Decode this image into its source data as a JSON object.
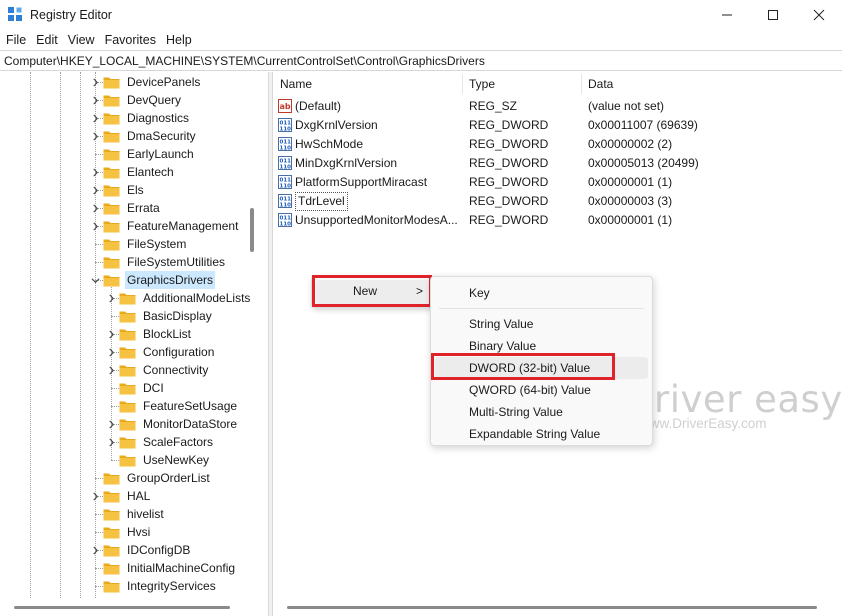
{
  "window": {
    "title": "Registry Editor"
  },
  "menu": [
    "File",
    "Edit",
    "View",
    "Favorites",
    "Help"
  ],
  "address": "Computer\\HKEY_LOCAL_MACHINE\\SYSTEM\\CurrentControlSet\\Control\\GraphicsDrivers",
  "tree": {
    "items": [
      {
        "label": "DevicePanels",
        "level": 0,
        "expander": "collapsed"
      },
      {
        "label": "DevQuery",
        "level": 0,
        "expander": "collapsed"
      },
      {
        "label": "Diagnostics",
        "level": 0,
        "expander": "collapsed"
      },
      {
        "label": "DmaSecurity",
        "level": 0,
        "expander": "collapsed"
      },
      {
        "label": "EarlyLaunch",
        "level": 0,
        "expander": "none"
      },
      {
        "label": "Elantech",
        "level": 0,
        "expander": "collapsed"
      },
      {
        "label": "Els",
        "level": 0,
        "expander": "collapsed"
      },
      {
        "label": "Errata",
        "level": 0,
        "expander": "collapsed"
      },
      {
        "label": "FeatureManagement",
        "level": 0,
        "expander": "collapsed"
      },
      {
        "label": "FileSystem",
        "level": 0,
        "expander": "none"
      },
      {
        "label": "FileSystemUtilities",
        "level": 0,
        "expander": "none"
      },
      {
        "label": "GraphicsDrivers",
        "level": 0,
        "expander": "expanded",
        "selected": true
      },
      {
        "label": "AdditionalModeLists",
        "level": 1,
        "expander": "collapsed"
      },
      {
        "label": "BasicDisplay",
        "level": 1,
        "expander": "none"
      },
      {
        "label": "BlockList",
        "level": 1,
        "expander": "collapsed"
      },
      {
        "label": "Configuration",
        "level": 1,
        "expander": "collapsed"
      },
      {
        "label": "Connectivity",
        "level": 1,
        "expander": "collapsed"
      },
      {
        "label": "DCI",
        "level": 1,
        "expander": "none"
      },
      {
        "label": "FeatureSetUsage",
        "level": 1,
        "expander": "none"
      },
      {
        "label": "MonitorDataStore",
        "level": 1,
        "expander": "collapsed"
      },
      {
        "label": "ScaleFactors",
        "level": 1,
        "expander": "collapsed"
      },
      {
        "label": "UseNewKey",
        "level": 1,
        "expander": "none"
      },
      {
        "label": "GroupOrderList",
        "level": 0,
        "expander": "none"
      },
      {
        "label": "HAL",
        "level": 0,
        "expander": "collapsed"
      },
      {
        "label": "hivelist",
        "level": 0,
        "expander": "none"
      },
      {
        "label": "Hvsi",
        "level": 0,
        "expander": "none"
      },
      {
        "label": "IDConfigDB",
        "level": 0,
        "expander": "collapsed"
      },
      {
        "label": "InitialMachineConfig",
        "level": 0,
        "expander": "none"
      },
      {
        "label": "IntegrityServices",
        "level": 0,
        "expander": "none"
      }
    ]
  },
  "columns": {
    "name": "Name",
    "type": "Type",
    "data": "Data"
  },
  "values": [
    {
      "name": "(Default)",
      "type": "REG_SZ",
      "data": "(value not set)",
      "icon": "string-value-icon"
    },
    {
      "name": "DxgKrnlVersion",
      "type": "REG_DWORD",
      "data": "0x00011007 (69639)",
      "icon": "binary-value-icon"
    },
    {
      "name": "HwSchMode",
      "type": "REG_DWORD",
      "data": "0x00000002 (2)",
      "icon": "binary-value-icon"
    },
    {
      "name": "MinDxgKrnlVersion",
      "type": "REG_DWORD",
      "data": "0x00005013 (20499)",
      "icon": "binary-value-icon"
    },
    {
      "name": "PlatformSupportMiracast",
      "type": "REG_DWORD",
      "data": "0x00000001 (1)",
      "icon": "binary-value-icon"
    },
    {
      "name": "TdrLevel",
      "type": "REG_DWORD",
      "data": "0x00000003 (3)",
      "icon": "binary-value-icon",
      "focused": true
    },
    {
      "name": "UnsupportedMonitorModesA...",
      "type": "REG_DWORD",
      "data": "0x00000001 (1)",
      "icon": "binary-value-icon"
    }
  ],
  "context_menu": {
    "new_label": "New",
    "new_arrow": ">"
  },
  "submenu": {
    "key": "Key",
    "string_value": "String Value",
    "binary_value": "Binary Value",
    "dword_value": "DWORD (32-bit) Value",
    "qword_value": "QWORD (64-bit) Value",
    "multi_string_value": "Multi-String Value",
    "expandable_string_value": "Expandable String Value"
  },
  "watermark": {
    "brand": "driver easy",
    "url": "www.DriverEasy.com"
  },
  "colors": {
    "highlight_box": "#e0222b",
    "selection": "#cce8ff",
    "folder": "#f5c242"
  }
}
